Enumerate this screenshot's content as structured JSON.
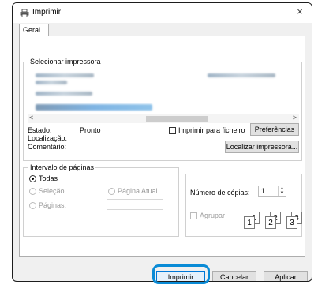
{
  "window": {
    "title": "Imprimir",
    "close_glyph": "×"
  },
  "tabs": [
    {
      "label": "Geral"
    }
  ],
  "printer_group": {
    "legend": "Selecionar impressora"
  },
  "status": {
    "estado_label": "Estado:",
    "estado_value": "Pronto",
    "localizacao_label": "Localização:",
    "comentario_label": "Comentário:"
  },
  "print_to_file": {
    "label": "Imprimir para ficheiro",
    "checked": false
  },
  "buttons": {
    "preferences": "Preferências",
    "find_printer": "Localizar impressora...",
    "print": "Imprimir",
    "cancel": "Cancelar",
    "apply": "Aplicar"
  },
  "page_range": {
    "legend": "Intervalo de páginas",
    "all": "Todas",
    "selection": "Seleção",
    "current_page": "Página Atual",
    "pages": "Páginas:"
  },
  "copies": {
    "label": "Número de cópias:",
    "value": "1"
  },
  "collate": {
    "label": "Agrupar",
    "pages": [
      "1",
      "1",
      "2",
      "2",
      "3",
      "3"
    ]
  },
  "scroll": {
    "left": "<",
    "right": ">"
  },
  "colors": {
    "accent": "#0a8bd6"
  }
}
